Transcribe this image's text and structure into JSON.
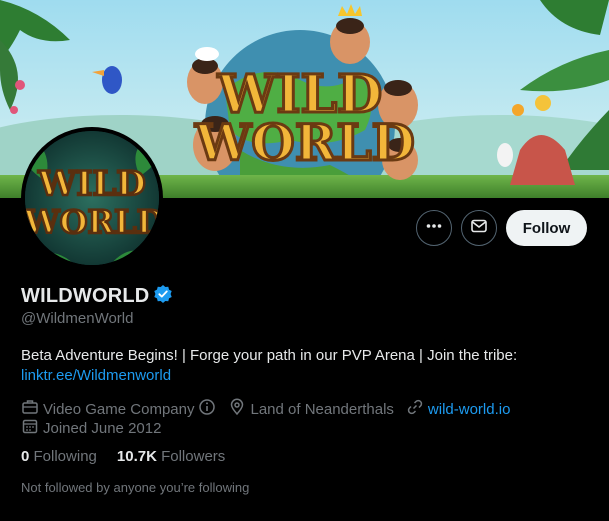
{
  "banner": {
    "logo_line1": "WILD",
    "logo_line2": "WORLD"
  },
  "avatar": {
    "logo_line1": "WILD",
    "logo_line2": "WORLD"
  },
  "actions": {
    "more_icon": "more-icon",
    "message_icon": "mail-icon",
    "follow_label": "Follow"
  },
  "profile": {
    "name": "WILDWORLD",
    "verified_icon": "verified-badge-icon",
    "handle": "@WildmenWorld",
    "bio_text": "Beta Adventure Begins! | Forge your path in our PVP Arena  | Join the tribe:",
    "bio_link": "linktr.ee/Wildmenworld"
  },
  "meta": {
    "category": "Video Game Company",
    "location": "Land of Neanderthals",
    "website": "wild-world.io",
    "joined": "Joined June 2012"
  },
  "counts": {
    "following_value": "0",
    "following_label": "Following",
    "followers_value": "10.7K",
    "followers_label": "Followers"
  },
  "not_followed": "Not followed by anyone you’re following",
  "colors": {
    "accent": "#1d9bf0",
    "muted": "#71767b",
    "text": "#e7e9ea"
  }
}
